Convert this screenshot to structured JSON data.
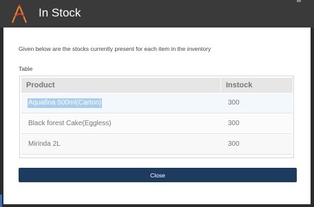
{
  "window": {
    "title": "In Stock",
    "logo_icon": "app-logo-icon",
    "logo_colors": [
      "#f08a24",
      "#e2352b"
    ]
  },
  "dialog": {
    "description": "Given below are the stocks currently present for each item in the inventory",
    "table_label": "Table",
    "table": {
      "columns": [
        "Product",
        "Instock"
      ],
      "rows": [
        {
          "product": "Aquafina 500ml(Carton)",
          "instock": "300",
          "selected": true
        },
        {
          "product": "Black forest Cake(Eggless)",
          "instock": "300",
          "selected": false
        },
        {
          "product": "Mirinda 2L",
          "instock": "300",
          "selected": false
        }
      ]
    },
    "close_label": "Close"
  },
  "colors": {
    "titlebar": "#3a3a3a",
    "close_button": "#1d3a5f",
    "selection": "#a8cdf0"
  }
}
